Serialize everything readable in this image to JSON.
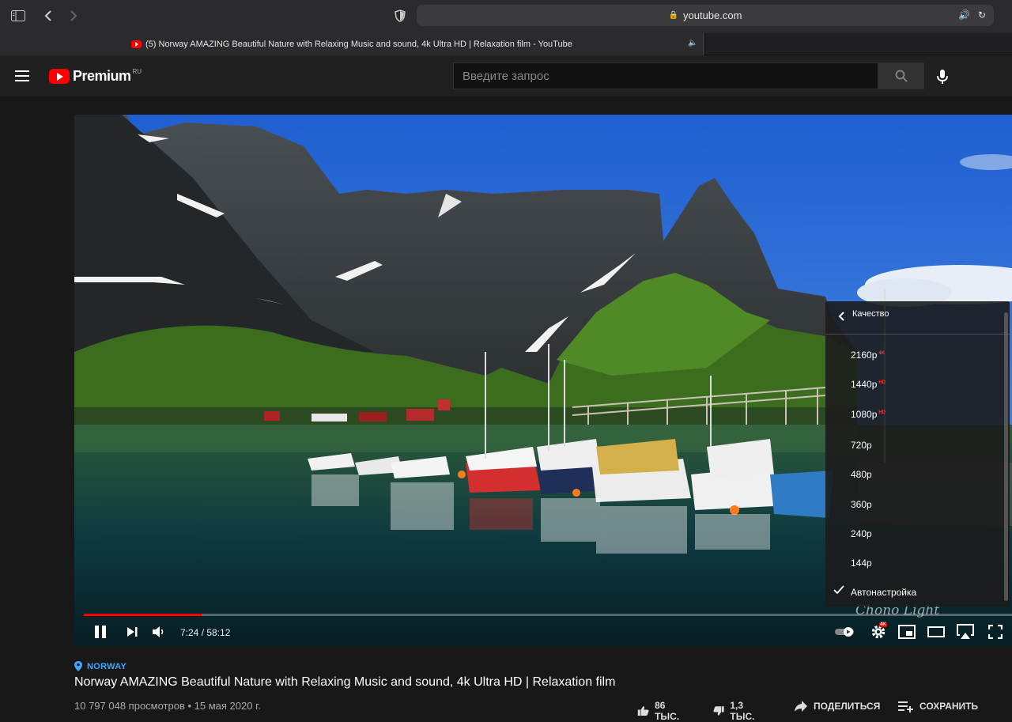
{
  "browser": {
    "url": "youtube.com",
    "tab_title": "(5) Norway AMAZING Beautiful Nature with Relaxing Music and sound, 4k Ultra HD | Relaxation film - YouTube"
  },
  "masthead": {
    "logo_text": "Premium",
    "region": "RU",
    "search_placeholder": "Введите запрос"
  },
  "player": {
    "current_time": "7:24",
    "duration": "58:12",
    "time_display": "7:24 / 58:12",
    "progress_fraction": 0.127,
    "watermark": "Chono Light",
    "settings_badge": "4K",
    "quality_menu": {
      "title": "Качество",
      "options": [
        {
          "label": "2160p",
          "badge": "4K",
          "selected": false
        },
        {
          "label": "1440p",
          "badge": "HD",
          "selected": false
        },
        {
          "label": "1080p",
          "badge": "HD",
          "selected": false
        },
        {
          "label": "720p",
          "badge": "",
          "selected": false
        },
        {
          "label": "480p",
          "badge": "",
          "selected": false
        },
        {
          "label": "360p",
          "badge": "",
          "selected": false
        },
        {
          "label": "240p",
          "badge": "",
          "selected": false
        },
        {
          "label": "144p",
          "badge": "",
          "selected": false
        },
        {
          "label": "Автонастройка",
          "badge": "",
          "selected": true
        }
      ]
    }
  },
  "video": {
    "location": "NORWAY",
    "title": "Norway AMAZING Beautiful Nature with Relaxing Music and sound, 4k Ultra HD | Relaxation film",
    "views": "10 797 048 просмотров",
    "date": "15 мая 2020 г.",
    "meta_line": "10 797 048 просмотров • 15 мая 2020 г.",
    "likes": "86 ТЫС.",
    "dislikes": "1,3 ТЫС.",
    "share_label": "ПОДЕЛИТЬСЯ",
    "save_label": "СОХРАНИТЬ"
  },
  "colors": {
    "accent_red": "#ff0000",
    "link_blue": "#3ea6ff",
    "background": "#181818"
  }
}
